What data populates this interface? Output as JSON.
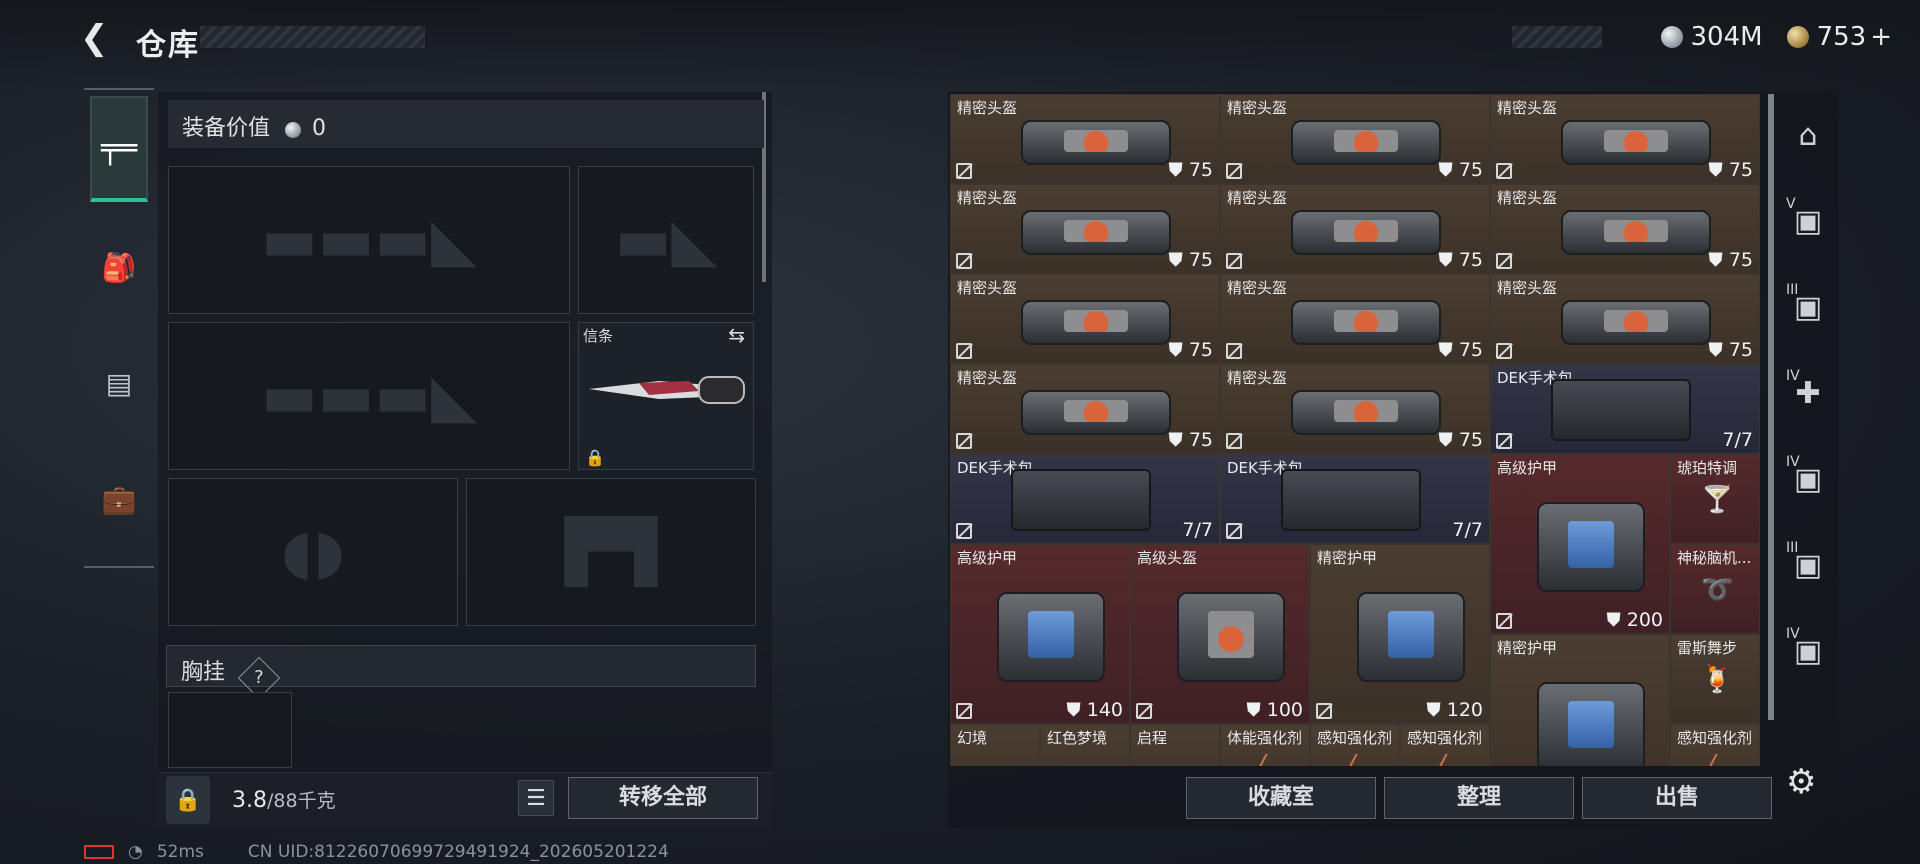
{
  "header": {
    "title": "仓库"
  },
  "currency": {
    "silver": "304M",
    "gold": "753",
    "gold_plus": "+"
  },
  "left_nav": {
    "items": [
      {
        "icon": "pistol-icon",
        "glyph": "⌐"
      },
      {
        "icon": "backpack-icon",
        "glyph": "⛉"
      },
      {
        "icon": "vest-icon",
        "glyph": "▤"
      },
      {
        "icon": "toolbox-icon",
        "glyph": "⧉"
      }
    ]
  },
  "equipment": {
    "value_label": "装备价值",
    "value": "0",
    "melee_slot": {
      "label": "信条"
    },
    "chest_rig_label": "胸挂",
    "chest_rig_help": "?"
  },
  "weight": {
    "current": "3.8",
    "max": "/88千克"
  },
  "buttons": {
    "transfer_all": "转移全部",
    "collection": "收藏室",
    "organize": "整理",
    "sell": "出售"
  },
  "status": {
    "ping": "52ms",
    "uid": "CN UID:8122607069972949192​4_202605201224"
  },
  "stash": {
    "items": [
      {
        "name": "精密头盔",
        "value": "75",
        "style": "brown",
        "kind": "bag",
        "lab": "o"
      },
      {
        "name": "精密头盔",
        "value": "75",
        "style": "brown",
        "kind": "bag",
        "lab": "o"
      },
      {
        "name": "精密头盔",
        "value": "75",
        "style": "brown",
        "kind": "bag",
        "lab": "o"
      },
      {
        "name": "精密头盔",
        "value": "75",
        "style": "brown",
        "kind": "bag",
        "lab": "o"
      },
      {
        "name": "精密头盔",
        "value": "75",
        "style": "brown",
        "kind": "bag",
        "lab": "o"
      },
      {
        "name": "精密头盔",
        "value": "75",
        "style": "brown",
        "kind": "bag",
        "lab": "o"
      },
      {
        "name": "精密头盔",
        "value": "75",
        "style": "brown",
        "kind": "bag",
        "lab": "o"
      },
      {
        "name": "精密头盔",
        "value": "75",
        "style": "brown",
        "kind": "bag",
        "lab": "o"
      },
      {
        "name": "精密头盔",
        "value": "75",
        "style": "brown",
        "kind": "bag",
        "lab": "o"
      },
      {
        "name": "精密头盔",
        "value": "75",
        "style": "brown",
        "kind": "bag",
        "lab": "o"
      },
      {
        "name": "精密头盔",
        "value": "75",
        "style": "brown",
        "kind": "bag",
        "lab": "o"
      },
      {
        "name": "DEK手术包",
        "value": "7/7",
        "style": "blue",
        "kind": "med"
      },
      {
        "name": "DEK手术包",
        "value": "7/7",
        "style": "blue",
        "kind": "med"
      },
      {
        "name": "DEK手术包",
        "value": "7/7",
        "style": "blue",
        "kind": "med"
      },
      {
        "name": "高级护甲",
        "value": "200",
        "style": "red",
        "kind": "bag",
        "lab": "b"
      },
      {
        "name": "琥珀特调",
        "value": "",
        "style": "red",
        "kind": "small",
        "glyph": "🍸"
      },
      {
        "name": "神秘脑机...",
        "value": "",
        "style": "red",
        "kind": "small",
        "glyph": "➰"
      },
      {
        "name": "高级护甲",
        "value": "140",
        "style": "red",
        "kind": "bag",
        "lab": "b"
      },
      {
        "name": "高级头盔",
        "value": "100",
        "style": "red",
        "kind": "bag",
        "lab": "o"
      },
      {
        "name": "精密护甲",
        "value": "120",
        "style": "brown",
        "kind": "bag",
        "lab": "b"
      },
      {
        "name": "精密护甲",
        "value": "",
        "style": "brown",
        "kind": "bag",
        "lab": "b"
      },
      {
        "name": "雷斯舞步",
        "value": "",
        "style": "brown",
        "kind": "small",
        "glyph": "🍹"
      },
      {
        "name": "幻境",
        "value": "",
        "style": "brown",
        "kind": "small",
        "glyph": "◡"
      },
      {
        "name": "红色梦境",
        "value": "",
        "style": "brown",
        "kind": "small",
        "glyph": "◡"
      },
      {
        "name": "启程",
        "value": "",
        "style": "brown",
        "kind": "small",
        "glyph": "◡"
      },
      {
        "name": "体能强化剂",
        "value": "",
        "style": "brown",
        "kind": "small",
        "glyph": "╱"
      },
      {
        "name": "感知强化剂",
        "value": "",
        "style": "brown",
        "kind": "small",
        "glyph": "╱"
      },
      {
        "name": "感知强化剂",
        "value": "",
        "style": "brown",
        "kind": "small",
        "glyph": "╱"
      },
      {
        "name": "感知强化剂",
        "value": "",
        "style": "brown",
        "kind": "small",
        "glyph": "╱"
      }
    ]
  },
  "right_nav": {
    "items": [
      {
        "icon": "helmet-icon",
        "tier": ""
      },
      {
        "icon": "armor-v-icon",
        "tier": "V"
      },
      {
        "icon": "armor-iii-icon",
        "tier": "III"
      },
      {
        "icon": "medkit-iv-icon",
        "tier": "IV"
      },
      {
        "icon": "gear-iv-icon",
        "tier": "IV"
      },
      {
        "icon": "gear-iii-icon",
        "tier": "III"
      },
      {
        "icon": "gear-iv-b-icon",
        "tier": "IV"
      }
    ]
  }
}
